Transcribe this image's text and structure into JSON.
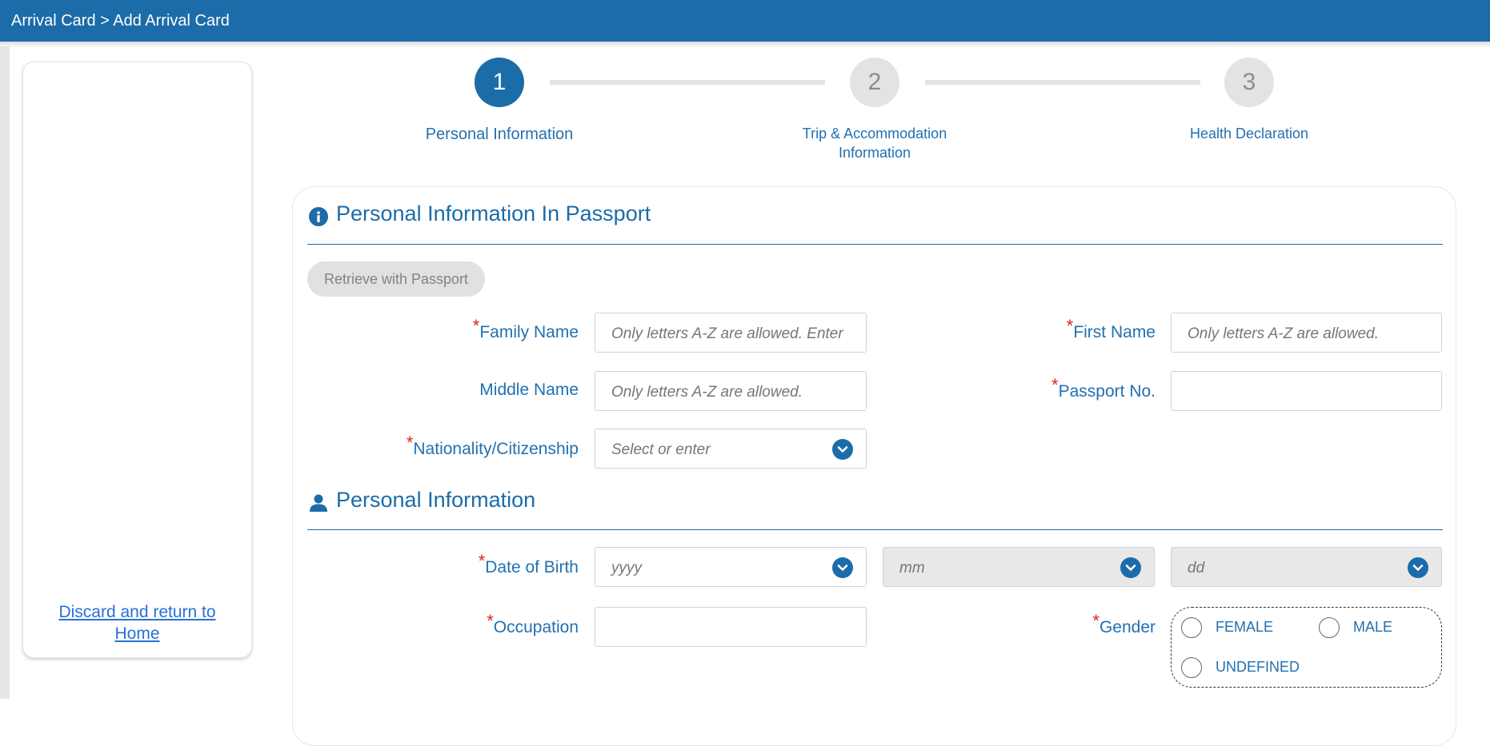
{
  "header": {
    "breadcrumb": "Arrival Card > Add Arrival Card"
  },
  "sidebar": {
    "discard_line1": "Discard and return to",
    "discard_line2": "Home"
  },
  "stepper": {
    "steps": [
      {
        "number": "1",
        "label_line1": "Personal Information",
        "label_line2": "",
        "active": true
      },
      {
        "number": "2",
        "label_line1": "Trip & Accommodation",
        "label_line2": "Information",
        "active": false
      },
      {
        "number": "3",
        "label_line1": "Health Declaration",
        "label_line2": "",
        "active": false
      }
    ]
  },
  "passport_section": {
    "title": "Personal Information In Passport",
    "retrieve_button": "Retrieve with Passport",
    "fields": {
      "family_name": {
        "label": "Family Name",
        "required": "*",
        "placeholder": "Only letters A-Z are allowed. Enter"
      },
      "first_name": {
        "label": "First Name",
        "required": "*",
        "placeholder": "Only letters A-Z are allowed."
      },
      "middle_name": {
        "label": "Middle Name",
        "placeholder": "Only letters A-Z are allowed."
      },
      "passport_no": {
        "label": "Passport No.",
        "required": "*",
        "placeholder": ""
      },
      "nationality": {
        "label": "Nationality/Citizenship",
        "required": "*",
        "placeholder": "Select or enter"
      }
    }
  },
  "personal_section": {
    "title": "Personal Information",
    "fields": {
      "dob": {
        "label": "Date of Birth",
        "required": "*",
        "year_placeholder": "yyyy",
        "month_placeholder": "mm",
        "day_placeholder": "dd"
      },
      "occupation": {
        "label": "Occupation",
        "required": "*"
      },
      "gender": {
        "label": "Gender",
        "required": "*",
        "options": [
          "FEMALE",
          "MALE",
          "UNDEFINED"
        ]
      }
    }
  },
  "colors": {
    "primary": "#1b6ca8",
    "label": "#2270b0",
    "required": "#e0211f",
    "link": "#2a6fd6"
  },
  "icons": {
    "passport_section": "info-circle-icon",
    "personal_section": "person-icon",
    "dropdown": "chevron-down-icon"
  }
}
